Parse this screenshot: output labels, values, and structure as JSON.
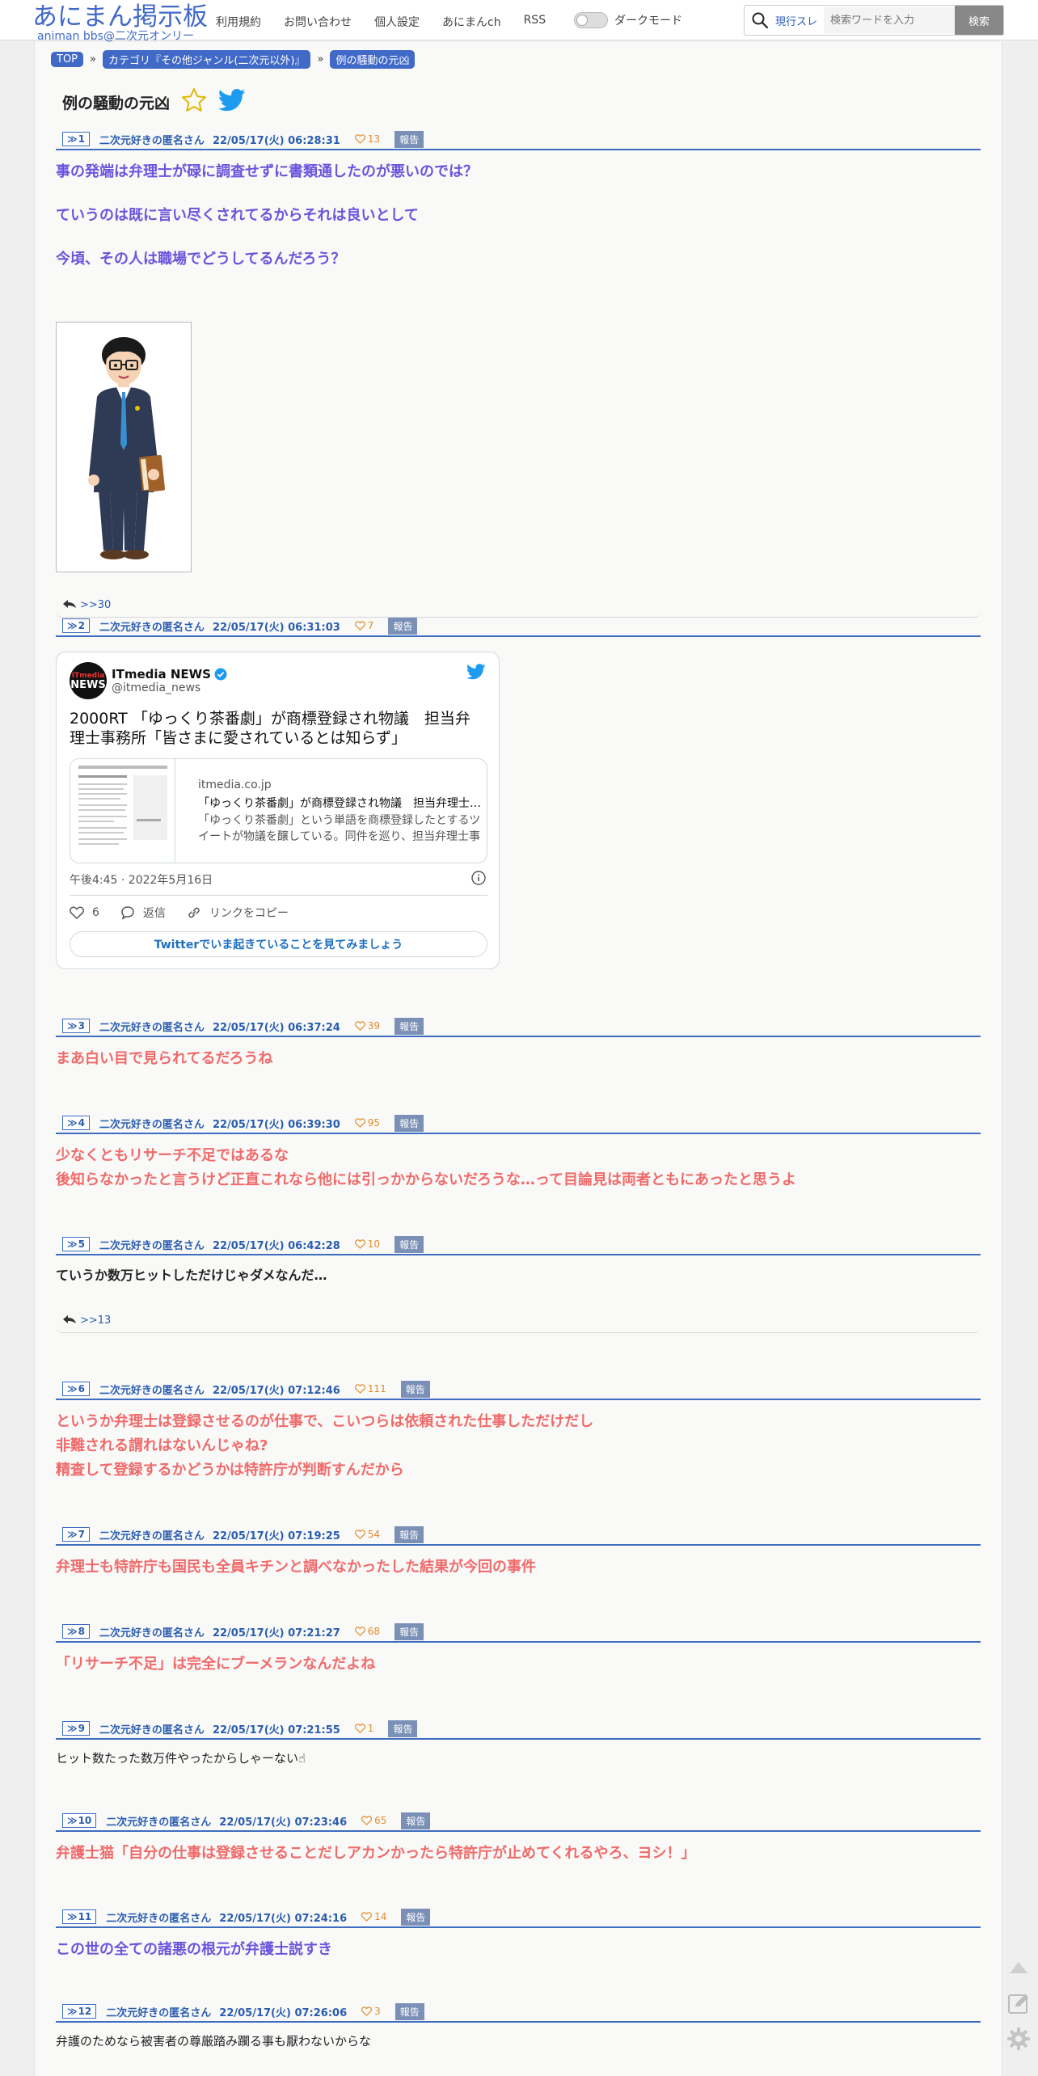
{
  "header": {
    "logo_main": "あにまん掲示板",
    "logo_sub": "animan bbs@二次元オンリー",
    "nav": [
      "利用規約",
      "お問い合わせ",
      "個人設定",
      "あにまんch",
      "RSS"
    ],
    "dark_mode_label": "ダークモード",
    "search_scope": "現行スレ",
    "search_placeholder": "検索ワードを入力",
    "search_button": "検索"
  },
  "breadcrumb": [
    "TOP",
    "カテゴリ『その他ジャンル(二次元以外)』",
    "例の騒動の元凶"
  ],
  "thread_title": "例の騒動の元凶",
  "posts": [
    {
      "no": "1",
      "name": "二次元好きの匿名さん",
      "date": "22/05/17(火) 06:28:31",
      "likes": "13",
      "report": "報告",
      "lines": [
        "事の発端は弁理士が碌に調査せずに書類通したのが悪いのでは？",
        "ていうのは既に言い尽くされてるからそれは良いとして",
        "今頃、その人は職場でどうしてるんだろう？"
      ],
      "reply": ">>30"
    },
    {
      "no": "2",
      "name": "二次元好きの匿名さん",
      "date": "22/05/17(火) 06:31:03",
      "likes": "7",
      "report": "報告"
    },
    {
      "no": "3",
      "name": "二次元好きの匿名さん",
      "date": "22/05/17(火) 06:37:24",
      "likes": "39",
      "report": "報告",
      "lines": [
        "まあ白い目で見られてるだろうね"
      ]
    },
    {
      "no": "4",
      "name": "二次元好きの匿名さん",
      "date": "22/05/17(火) 06:39:30",
      "likes": "95",
      "report": "報告",
      "lines": [
        "少なくともリサーチ不足ではあるな",
        "後知らなかったと言うけど正直これなら他には引っかからないだろうな…って目論見は両者ともにあったと思うよ"
      ]
    },
    {
      "no": "5",
      "name": "二次元好きの匿名さん",
      "date": "22/05/17(火) 06:42:28",
      "likes": "10",
      "report": "報告",
      "lines": [
        "ていうか数万ヒットしただけじゃダメなんだ…"
      ],
      "reply": ">>13"
    },
    {
      "no": "6",
      "name": "二次元好きの匿名さん",
      "date": "22/05/17(火) 07:12:46",
      "likes": "111",
      "report": "報告",
      "lines": [
        "というか弁理士は登録させるのが仕事で、こいつらは依頼された仕事しただけだし",
        "非難される謂れはないんじゃね?",
        "精査して登録するかどうかは特許庁が判断すんだから"
      ]
    },
    {
      "no": "7",
      "name": "二次元好きの匿名さん",
      "date": "22/05/17(火) 07:19:25",
      "likes": "54",
      "report": "報告",
      "lines": [
        "弁理士も特許庁も国民も全員キチンと調べなかったした結果が今回の事件"
      ]
    },
    {
      "no": "8",
      "name": "二次元好きの匿名さん",
      "date": "22/05/17(火) 07:21:27",
      "likes": "68",
      "report": "報告",
      "lines": [
        "「リサーチ不足」は完全にブーメランなんだよね"
      ]
    },
    {
      "no": "9",
      "name": "二次元好きの匿名さん",
      "date": "22/05/17(火) 07:21:55",
      "likes": "1",
      "report": "報告",
      "lines": [
        "ヒット数たった数万件やったからしゃーない☝"
      ]
    },
    {
      "no": "10",
      "name": "二次元好きの匿名さん",
      "date": "22/05/17(火) 07:23:46",
      "likes": "65",
      "report": "報告",
      "lines": [
        "弁護士猫「自分の仕事は登録させることだしアカンかったら特許庁が止めてくれるやろ、ヨシ！」"
      ]
    },
    {
      "no": "11",
      "name": "二次元好きの匿名さん",
      "date": "22/05/17(火) 07:24:16",
      "likes": "14",
      "report": "報告",
      "lines": [
        "この世の全ての諸悪の根元が弁護士説すき"
      ]
    },
    {
      "no": "12",
      "name": "二次元好きの匿名さん",
      "date": "22/05/17(火) 07:26:06",
      "likes": "3",
      "report": "報告",
      "lines": [
        "弁護のためなら被害者の尊厳踏み躙る事も厭わないからな"
      ]
    }
  ],
  "tweet": {
    "avatar_top": "ITmedia",
    "avatar_bottom": "NEWS",
    "name": "ITmedia NEWS",
    "handle": "@itmedia_news",
    "text": "2000RT 「ゆっくり茶番劇」が商標登録され物議　担当弁理士事務所「皆さまに愛されているとは知らず」",
    "link_domain": "itmedia.co.jp",
    "link_title": "「ゆっくり茶番劇」が商標登録され物議　担当弁理士事務所「皆さまに愛されているとは知らず」",
    "link_desc": "「ゆっくり茶番劇」という単語を商標登録したとするツイートが物議を醸している。同件を巡り、担当弁理士事務所が",
    "time": "午後4:45 · 2022年5月16日",
    "like_count": "6",
    "reply_label": "返信",
    "copy_label": "リンクをコピー",
    "cta": "Twitterでいま起きていることを見てみましょう"
  },
  "colors": {
    "accent": "#4169c8",
    "blue_text": "#6a55dc",
    "red_text": "#f06a6a",
    "like": "#e28c2c",
    "report": "#7b90b6"
  }
}
